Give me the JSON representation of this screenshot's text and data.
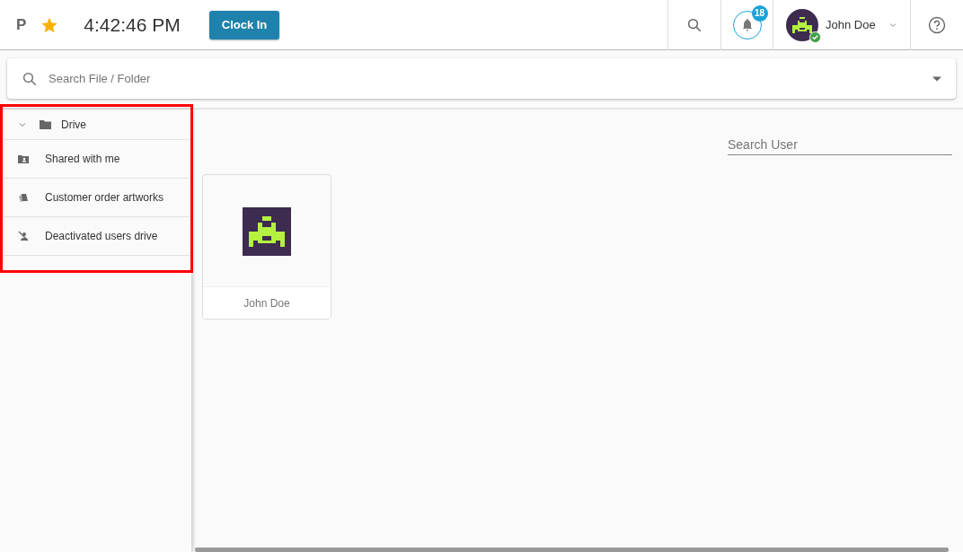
{
  "header": {
    "logo": "P",
    "favorite": true,
    "time": "4:42:46 PM",
    "clock_button": "Clock In",
    "notifications": "18",
    "user": {
      "name": "John Doe",
      "online": true
    }
  },
  "file_search": {
    "placeholder": "Search File / Folder"
  },
  "sidebar": {
    "highlighted": true,
    "items": [
      {
        "label": "Drive",
        "expanded": true,
        "children": [
          {
            "label": "Shared with me",
            "kind": "shared"
          },
          {
            "label": "Customer order artworks",
            "kind": "artworks"
          },
          {
            "label": "Deactivated users drive",
            "kind": "deactivated"
          }
        ]
      }
    ]
  },
  "user_search": {
    "placeholder": "Search User"
  },
  "users": [
    {
      "name": "John Doe"
    }
  ]
}
